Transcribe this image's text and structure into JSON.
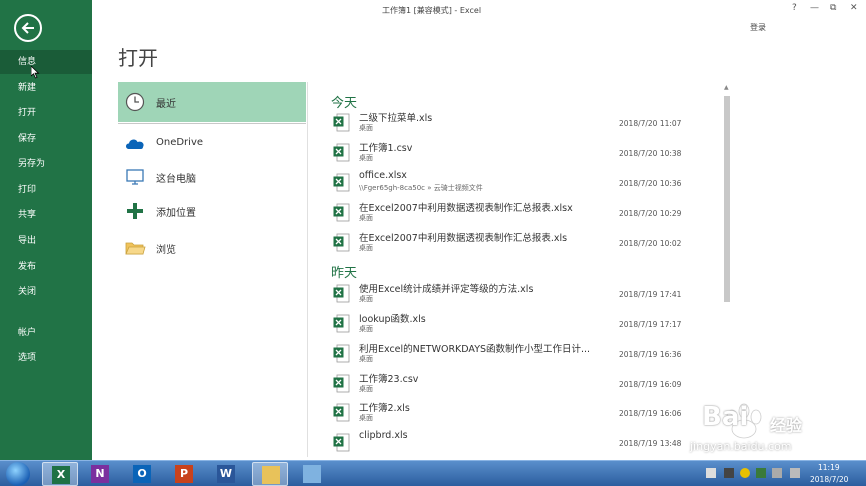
{
  "window": {
    "title": "工作簿1  [兼容模式] - Excel",
    "help": "?",
    "minimize": "—",
    "restore": "⧉",
    "close": "✕",
    "signin": "登录"
  },
  "nav": {
    "items": [
      {
        "label": "信息",
        "active": true
      },
      {
        "label": "新建"
      },
      {
        "label": "打开"
      },
      {
        "label": "保存"
      },
      {
        "label": "另存为"
      },
      {
        "label": "打印"
      },
      {
        "label": "共享"
      },
      {
        "label": "导出"
      },
      {
        "label": "发布"
      },
      {
        "label": "关闭"
      },
      {
        "label": "帐户"
      },
      {
        "label": "选项"
      }
    ]
  },
  "page": {
    "heading": "打开"
  },
  "locations": [
    {
      "label": "最近",
      "icon": "clock-icon",
      "active": true
    },
    {
      "label": "OneDrive",
      "icon": "cloud-icon"
    },
    {
      "label": "这台电脑",
      "icon": "computer-icon"
    },
    {
      "label": "添加位置",
      "icon": "plus-icon"
    },
    {
      "label": "浏览",
      "icon": "folder-icon"
    }
  ],
  "recent": {
    "today_label": "今天",
    "yesterday_label": "昨天",
    "today": [
      {
        "name": "二级下拉菜单.xls",
        "path": "桌面",
        "date": "2018/7/20 11:07"
      },
      {
        "name": "工作簿1.csv",
        "path": "桌面",
        "date": "2018/7/20 10:38"
      },
      {
        "name": "office.xlsx",
        "path": "\\\\Fger65gh-8ca50c » 云骑士视频文件",
        "date": "2018/7/20 10:36"
      },
      {
        "name": "在Excel2007中利用数据透视表制作汇总报表.xlsx",
        "path": "桌面",
        "date": "2018/7/20 10:29"
      },
      {
        "name": "在Excel2007中利用数据透视表制作汇总报表.xls",
        "path": "桌面",
        "date": "2018/7/20 10:02"
      }
    ],
    "yesterday": [
      {
        "name": "使用Excel统计成绩并评定等级的方法.xls",
        "path": "桌面",
        "date": "2018/7/19 17:41"
      },
      {
        "name": "lookup函数.xls",
        "path": "桌面",
        "date": "2018/7/19 17:17"
      },
      {
        "name": "利用Excel的NETWORKDAYS函数制作小型工作日计...",
        "path": "桌面",
        "date": "2018/7/19 16:36"
      },
      {
        "name": "工作簿23.csv",
        "path": "桌面",
        "date": "2018/7/19 16:09"
      },
      {
        "name": "工作簿2.xls",
        "path": "桌面",
        "date": "2018/7/19 16:06"
      },
      {
        "name": "clipbrd.xls",
        "path": "",
        "date": "2018/7/19 13:48"
      }
    ]
  },
  "watermark": {
    "brand": "Bai",
    "brand2": "经验",
    "url": "jingyan.baidu.com"
  },
  "taskbar": {
    "apps": [
      {
        "name": "excel",
        "glyph": "X",
        "color": "#1e7145",
        "active": true
      },
      {
        "name": "onenote",
        "glyph": "N",
        "color": "#7b2f9e"
      },
      {
        "name": "outlook",
        "glyph": "O",
        "color": "#0a64b8"
      },
      {
        "name": "powerpoint",
        "glyph": "P",
        "color": "#c8421c"
      },
      {
        "name": "word",
        "glyph": "W",
        "color": "#2a5699"
      },
      {
        "name": "explorer",
        "glyph": "",
        "color": "#e8c25a"
      },
      {
        "name": "app-window",
        "glyph": "",
        "color": "#7fb2e0"
      }
    ],
    "time": "11:19",
    "date": "2018/7/20"
  },
  "colors": {
    "accent": "#217346",
    "selected_location": "#9fd5b7",
    "taskbar": "#2b5d9e"
  }
}
